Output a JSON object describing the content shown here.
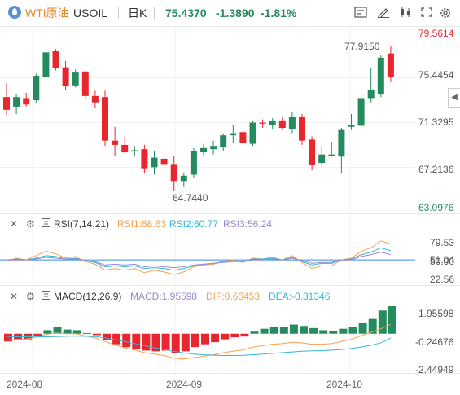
{
  "header": {
    "symbol_name": "WTI原油",
    "symbol_code": "USOIL",
    "period": "日K",
    "price": "75.4370",
    "change": "-1.3890",
    "change_pct": "-1.81%"
  },
  "colors": {
    "up": "#e8262e",
    "down": "#238b5e",
    "rsi1": "#f7a14d",
    "rsi2": "#36b6d6",
    "rsi3": "#9b86d3",
    "dif": "#f7a14d",
    "dea": "#36b6d6",
    "refline": "#3a8de0"
  },
  "price_axis": [
    "79.5614",
    "75.4454",
    "71.3295",
    "67.2136",
    "63.0976"
  ],
  "annotations": {
    "high": "77.9150",
    "low": "64.7440"
  },
  "rsi": {
    "label": "RSI(7,14,21)",
    "rsi1": "RSI1:68.63",
    "rsi2": "RSI2:60.77",
    "rsi3": "RSI3:56.24",
    "axis": [
      "79.53",
      "51.04",
      "50.00",
      "22.56"
    ]
  },
  "macd": {
    "label": "MACD(12,26,9)",
    "macd": "MACD:1.95598",
    "dif": "DIF:0.66453",
    "dea": "DEA:-0.31346",
    "axis": [
      "1.95598",
      "-0.24676",
      "-2.44949"
    ]
  },
  "x_axis": [
    "2024-08",
    "2024-09",
    "2024-10"
  ],
  "chart_data": {
    "type": "candlestick",
    "price_range": [
      63.0976,
      79.5614
    ],
    "candles": [
      {
        "o": 73.5,
        "h": 74.8,
        "l": 71.8,
        "c": 72.3
      },
      {
        "o": 72.6,
        "h": 73.8,
        "l": 71.9,
        "c": 73.5
      },
      {
        "o": 73.4,
        "h": 73.9,
        "l": 72.6,
        "c": 72.8
      },
      {
        "o": 73.2,
        "h": 75.7,
        "l": 72.9,
        "c": 75.5
      },
      {
        "o": 75.4,
        "h": 77.9,
        "l": 74.9,
        "c": 77.7
      },
      {
        "o": 77.8,
        "h": 78.0,
        "l": 76.0,
        "c": 76.2
      },
      {
        "o": 76.3,
        "h": 76.9,
        "l": 74.2,
        "c": 74.5
      },
      {
        "o": 74.6,
        "h": 76.1,
        "l": 74.4,
        "c": 75.8
      },
      {
        "o": 75.9,
        "h": 76.0,
        "l": 73.3,
        "c": 73.6
      },
      {
        "o": 73.6,
        "h": 74.1,
        "l": 72.5,
        "c": 73.0
      },
      {
        "o": 73.5,
        "h": 74.1,
        "l": 68.9,
        "c": 69.4
      },
      {
        "o": 69.4,
        "h": 70.7,
        "l": 67.9,
        "c": 69.0
      },
      {
        "o": 69.0,
        "h": 69.8,
        "l": 68.2,
        "c": 68.3
      },
      {
        "o": 68.4,
        "h": 68.9,
        "l": 67.9,
        "c": 68.5
      },
      {
        "o": 68.6,
        "h": 69.0,
        "l": 66.3,
        "c": 66.8
      },
      {
        "o": 66.9,
        "h": 68.4,
        "l": 66.2,
        "c": 67.8
      },
      {
        "o": 67.7,
        "h": 68.1,
        "l": 66.8,
        "c": 67.2
      },
      {
        "o": 67.2,
        "h": 68.0,
        "l": 64.7,
        "c": 65.6
      },
      {
        "o": 65.6,
        "h": 66.4,
        "l": 65.1,
        "c": 66.1
      },
      {
        "o": 66.2,
        "h": 68.7,
        "l": 65.9,
        "c": 68.4
      },
      {
        "o": 68.3,
        "h": 69.1,
        "l": 68.0,
        "c": 68.7
      },
      {
        "o": 68.6,
        "h": 69.4,
        "l": 68.1,
        "c": 68.9
      },
      {
        "o": 68.8,
        "h": 70.1,
        "l": 68.4,
        "c": 69.9
      },
      {
        "o": 69.9,
        "h": 70.9,
        "l": 69.2,
        "c": 70.1
      },
      {
        "o": 70.2,
        "h": 70.4,
        "l": 69.0,
        "c": 69.2
      },
      {
        "o": 69.1,
        "h": 71.3,
        "l": 68.9,
        "c": 71.1
      },
      {
        "o": 71.1,
        "h": 71.4,
        "l": 70.6,
        "c": 71.0
      },
      {
        "o": 70.9,
        "h": 71.5,
        "l": 70.5,
        "c": 71.3
      },
      {
        "o": 71.3,
        "h": 71.6,
        "l": 70.4,
        "c": 70.6
      },
      {
        "o": 70.5,
        "h": 72.1,
        "l": 70.1,
        "c": 71.6
      },
      {
        "o": 71.6,
        "h": 71.9,
        "l": 69.0,
        "c": 69.4
      },
      {
        "o": 69.5,
        "h": 69.8,
        "l": 66.6,
        "c": 67.1
      },
      {
        "o": 67.3,
        "h": 68.9,
        "l": 67.0,
        "c": 68.1
      },
      {
        "o": 68.0,
        "h": 69.3,
        "l": 67.9,
        "c": 68.1
      },
      {
        "o": 67.9,
        "h": 70.6,
        "l": 66.3,
        "c": 70.4
      },
      {
        "o": 70.7,
        "h": 71.9,
        "l": 70.4,
        "c": 70.9
      },
      {
        "o": 70.8,
        "h": 73.7,
        "l": 70.6,
        "c": 73.4
      },
      {
        "o": 73.4,
        "h": 76.2,
        "l": 73.0,
        "c": 74.2
      },
      {
        "o": 73.8,
        "h": 77.4,
        "l": 73.5,
        "c": 77.2
      },
      {
        "o": 77.6,
        "h": 78.3,
        "l": 74.9,
        "c": 75.4
      }
    ],
    "rsi_range": [
      22.56,
      79.53
    ],
    "rsi1": [
      48,
      52,
      50,
      55,
      60,
      57,
      52,
      54,
      48,
      45,
      38,
      40,
      38,
      40,
      35,
      38,
      36,
      33,
      36,
      42,
      44,
      45,
      48,
      50,
      47,
      52,
      51,
      53,
      50,
      55,
      47,
      40,
      43,
      43,
      50,
      52,
      60,
      64,
      72,
      68.63
    ],
    "rsi2": [
      50,
      51,
      50,
      52,
      55,
      54,
      51,
      52,
      49,
      47,
      42,
      43,
      42,
      43,
      40,
      41,
      40,
      38,
      40,
      43,
      45,
      46,
      48,
      49,
      48,
      51,
      51,
      52,
      50,
      53,
      48,
      44,
      46,
      46,
      50,
      51,
      56,
      59,
      64,
      60.77
    ],
    "rsi3": [
      50,
      50,
      50,
      51,
      53,
      52,
      51,
      51,
      49,
      48,
      44,
      45,
      44,
      45,
      42,
      43,
      42,
      41,
      42,
      44,
      45,
      46,
      47,
      48,
      48,
      50,
      50,
      51,
      50,
      52,
      49,
      46,
      47,
      47,
      50,
      50,
      54,
      56,
      59,
      56.24
    ],
    "macd_range": [
      -2.44949,
      1.95598
    ],
    "macd_hist": [
      -0.55,
      -0.45,
      -0.4,
      -0.15,
      0.25,
      0.45,
      0.3,
      0.25,
      0.05,
      -0.1,
      -0.45,
      -0.75,
      -0.95,
      -1.1,
      -1.2,
      -1.25,
      -1.2,
      -1.35,
      -1.25,
      -0.95,
      -0.75,
      -0.6,
      -0.4,
      -0.25,
      -0.2,
      0.15,
      0.35,
      0.5,
      0.5,
      0.65,
      0.55,
      0.4,
      0.25,
      0.2,
      0.35,
      0.45,
      0.8,
      1.05,
      1.65,
      1.95598
    ],
    "dif": [
      -0.45,
      -0.4,
      -0.38,
      -0.25,
      -0.05,
      0.05,
      0.0,
      0.0,
      -0.15,
      -0.3,
      -0.55,
      -0.8,
      -1.0,
      -1.15,
      -1.35,
      -1.45,
      -1.55,
      -1.75,
      -1.8,
      -1.7,
      -1.6,
      -1.5,
      -1.35,
      -1.25,
      -1.15,
      -0.95,
      -0.85,
      -0.75,
      -0.7,
      -0.6,
      -0.65,
      -0.75,
      -0.75,
      -0.7,
      -0.55,
      -0.4,
      -0.15,
      0.1,
      0.35,
      0.66453
    ],
    "dea": [
      -0.2,
      -0.22,
      -0.22,
      -0.23,
      -0.22,
      -0.2,
      -0.18,
      -0.17,
      -0.18,
      -0.2,
      -0.3,
      -0.42,
      -0.55,
      -0.7,
      -0.85,
      -1.0,
      -1.12,
      -1.25,
      -1.36,
      -1.45,
      -1.5,
      -1.53,
      -1.55,
      -1.55,
      -1.54,
      -1.5,
      -1.45,
      -1.4,
      -1.35,
      -1.3,
      -1.25,
      -1.22,
      -1.2,
      -1.17,
      -1.12,
      -1.05,
      -0.95,
      -0.82,
      -0.65,
      -0.31346
    ]
  }
}
